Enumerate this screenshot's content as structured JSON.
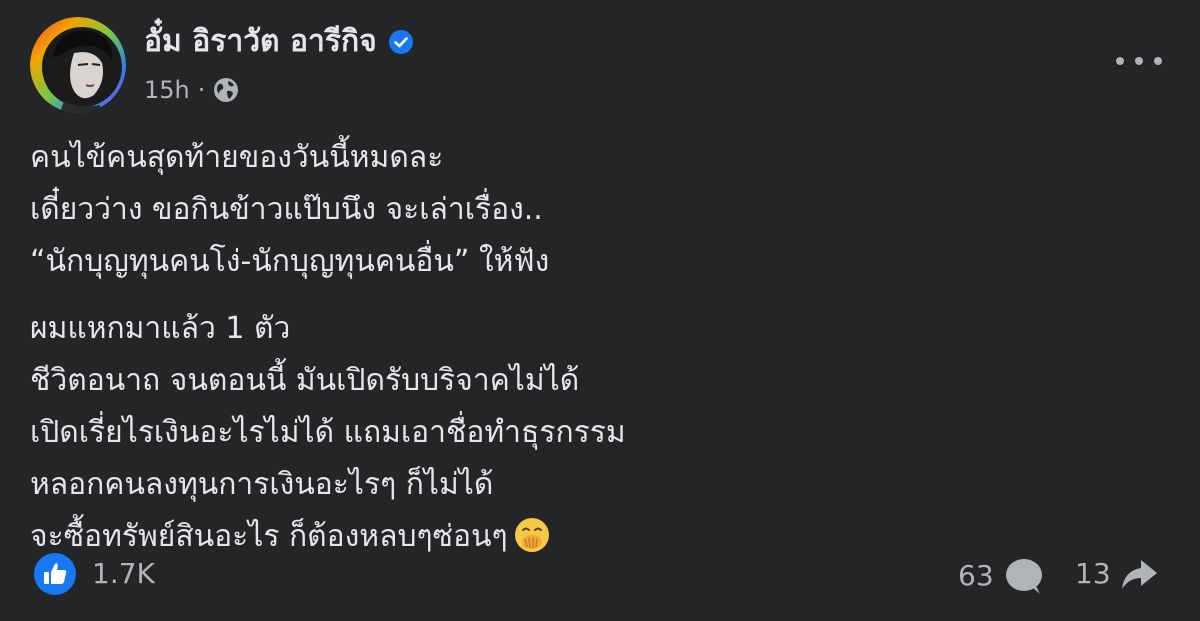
{
  "post": {
    "author": {
      "name": "อั๋ม อิราวัต อารีกิจ",
      "verified": true,
      "avatar_icon": "profile-photo"
    },
    "timestamp": "15h",
    "separator": "·",
    "audience_icon": "globe-icon",
    "more_icon": "more-options-icon",
    "paragraphs": [
      {
        "lines": [
          "คนไข้คนสุดท้ายของวันนี้หมดละ",
          "เดี๋ยวว่าง ขอกินข้าวแป๊บนึง จะเล่าเรื่อง..",
          "“นักบุญทุนคนโง่-นักบุญทุนคนอื่น” ให้ฟัง"
        ]
      },
      {
        "lines": [
          "ผมแหกมาแล้ว 1 ตัว",
          "ชีวิตอนาถ จนตอนนี้ มันเปิดรับบริจาคไม่ได้",
          "เปิดเรี่ยไรเงินอะไรไม่ได้ แถมเอาชื่อทำธุรกรรม",
          "หลอกคนลงทุนการเงินอะไรๆ ก็ไม่ได้",
          "จะซื้อทรัพย์สินอะไร ก็ต้องหลบๆซ่อนๆ"
        ],
        "trailing_emoji": "hand-over-mouth-emoji"
      }
    ],
    "reactions": {
      "like_count": "1.7K",
      "comment_count": "63",
      "share_count": "13"
    },
    "colors": {
      "background": "#242526",
      "primary_text": "#e4e6eb",
      "secondary_text": "#b0b3b8",
      "accent_blue": "#1877f2"
    }
  }
}
